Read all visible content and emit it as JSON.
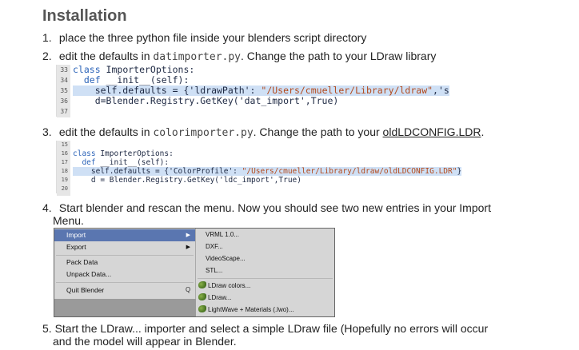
{
  "title": "Installation",
  "steps": [
    {
      "num": "1.",
      "text": "place the three python file inside your blenders script directory"
    },
    {
      "num": "2.",
      "pre": "edit the defaults in ",
      "code": "datimporter.py",
      "post": ". Change the path to your LDraw library"
    },
    {
      "num": "3.",
      "pre": "edit the defaults in ",
      "code": "colorimporter.py",
      "post": ". Change the path to your ",
      "link": "oldLDCONFIG.LDR",
      "tail": "."
    },
    {
      "num": "4.",
      "line1": "Start blender and rescan the menu. Now you should see two new entries in your Import",
      "line2": "Menu."
    },
    {
      "num": "5.",
      "line1": "Start the LDraw... importer and select a simple LDraw file (Hopefully no errors will occur",
      "line2": "and the model will appear in Blender."
    }
  ],
  "code1": [
    {
      "ln": "33",
      "kw": "class ",
      "rest": "ImporterOptions:"
    },
    {
      "ln": "34",
      "kw": "  def ",
      "rest": "__init__(self):"
    },
    {
      "ln": "35",
      "rest": "    self.defaults = {'ldrawPath': ",
      "str": "\"/Users/cmueller/Library/ldraw\"",
      "tail": ",'s"
    },
    {
      "ln": "36",
      "rest": "    d=Blender.Registry.GetKey('dat_import',True)"
    },
    {
      "ln": "37",
      "rest": ""
    }
  ],
  "code2": [
    {
      "ln": "15",
      "rest": ""
    },
    {
      "ln": "16",
      "kw": "class ",
      "rest": "ImporterOptions:"
    },
    {
      "ln": "17",
      "kw": "  def ",
      "rest": "__init__(self):"
    },
    {
      "ln": "18",
      "rest": "    self.defaults = {'ColorProfile': ",
      "str": "\"/Users/cmueller/Library/ldraw/oldLDCONFIG.LDR\"",
      "tail": "}"
    },
    {
      "ln": "19",
      "rest": "    d = Blender.Registry.GetKey('ldc_import',True)"
    },
    {
      "ln": "20",
      "rest": ""
    }
  ],
  "menu": {
    "left_items": [
      "Import",
      "Export",
      "Pack Data",
      "Unpack Data...",
      "Quit Blender"
    ],
    "shortcut": "Q",
    "right_items": [
      "VRML 1.0...",
      "DXF...",
      "VideoScape...",
      "STL...",
      "LDraw colors...",
      "LDraw...",
      "LightWave + Materials (.lwo)..."
    ],
    "active_color": "#5a76b0"
  }
}
